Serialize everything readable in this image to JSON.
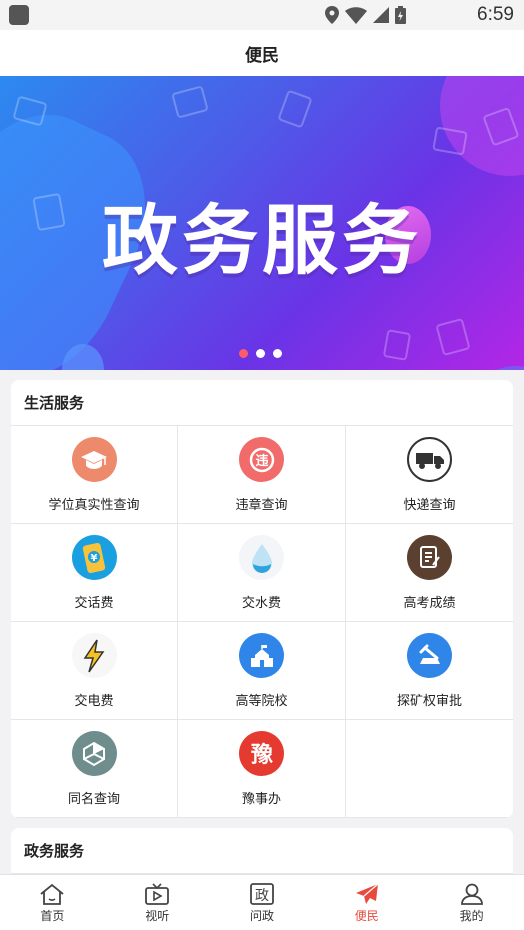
{
  "status_bar": {
    "time": "6:59",
    "icons": [
      "location-icon",
      "wifi-icon",
      "signal-icon",
      "battery-icon"
    ]
  },
  "header": {
    "title": "便民"
  },
  "banner": {
    "title": "政务服务",
    "slides": 3,
    "active_slide": 1
  },
  "sections": [
    {
      "title": "生活服务",
      "items": [
        {
          "label": "学位真实性查询",
          "icon": "graduation-cap-icon",
          "color": "#ee8a6c"
        },
        {
          "label": "违章查询",
          "icon": "violation-icon",
          "color": "#f26b6b"
        },
        {
          "label": "快递查询",
          "icon": "delivery-truck-icon",
          "color": "#ffffff"
        },
        {
          "label": "交话费",
          "icon": "phone-yuan-icon",
          "color": "#1a9fe0"
        },
        {
          "label": "交水费",
          "icon": "water-drop-icon",
          "color": "#f3f5f8"
        },
        {
          "label": "高考成绩",
          "icon": "score-sheet-icon",
          "color": "#5b4030"
        },
        {
          "label": "交电费",
          "icon": "lightning-icon",
          "color": "#ffffff"
        },
        {
          "label": "高等院校",
          "icon": "college-building-icon",
          "color": "#2f86e8"
        },
        {
          "label": "探矿权审批",
          "icon": "mining-icon",
          "color": "#2f86e8"
        },
        {
          "label": "同名查询",
          "icon": "cube-icon",
          "color": "#6f8d8d"
        },
        {
          "label": "豫事办",
          "icon": "yu-seal-icon",
          "color": "#e53a2f"
        }
      ]
    },
    {
      "title": "政务服务"
    }
  ],
  "tabbar": {
    "items": [
      {
        "label": "首页",
        "icon": "home-icon"
      },
      {
        "label": "视听",
        "icon": "tv-icon"
      },
      {
        "label": "问政",
        "icon": "zheng-icon",
        "glyph": "政"
      },
      {
        "label": "便民",
        "icon": "paper-plane-icon"
      },
      {
        "label": "我的",
        "icon": "user-icon"
      }
    ],
    "active_index": 3,
    "active_color": "#e84a3d"
  }
}
